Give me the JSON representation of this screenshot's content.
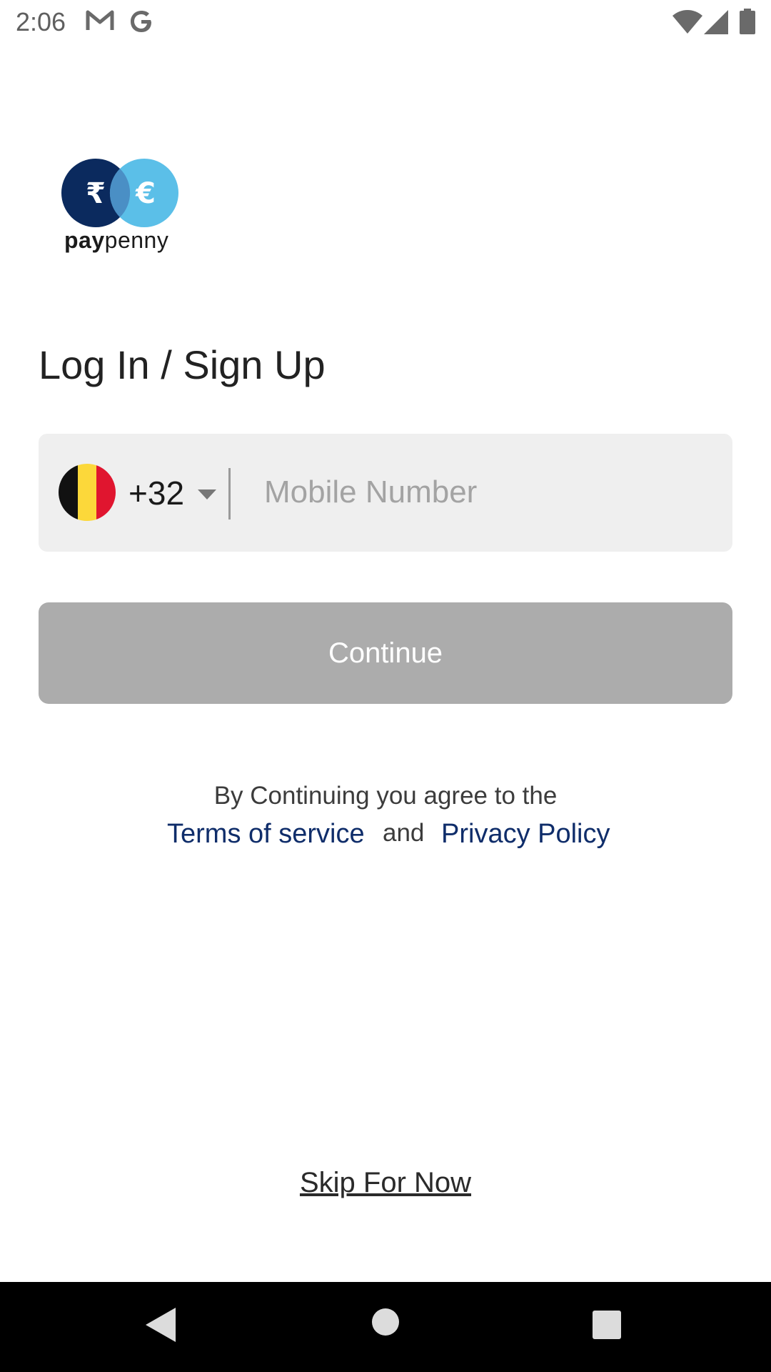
{
  "status_bar": {
    "time": "2:06",
    "icons": [
      "gmail-icon",
      "google-icon",
      "wifi-icon",
      "cell-signal-icon",
      "battery-icon"
    ]
  },
  "logo": {
    "brand_pay": "pay",
    "brand_penny": "penny",
    "rupee_symbol": "₹",
    "euro_symbol": "€",
    "colors": {
      "dark_circle": "#0b2a5e",
      "light_circle": "#5bbfe8",
      "overlap": "#4a8fc5"
    }
  },
  "login": {
    "title": "Log In / Sign Up"
  },
  "phone_input": {
    "country_flag": "belgium-flag-icon",
    "flag_colors": [
      "#111111",
      "#fcd83a",
      "#e0152f"
    ],
    "dial_code": "+32",
    "placeholder": "Mobile Number",
    "value": ""
  },
  "continue_button": {
    "label": "Continue",
    "enabled": false,
    "color": "#acacac"
  },
  "terms": {
    "prefix": "By Continuing you agree to the",
    "terms_link": "Terms of service",
    "and": "and",
    "privacy_link": "Privacy Policy",
    "link_color": "#0f2d6a"
  },
  "skip": {
    "label": "Skip For Now"
  },
  "nav_bar": {
    "buttons": [
      "back-icon",
      "home-icon",
      "recents-icon"
    ]
  }
}
